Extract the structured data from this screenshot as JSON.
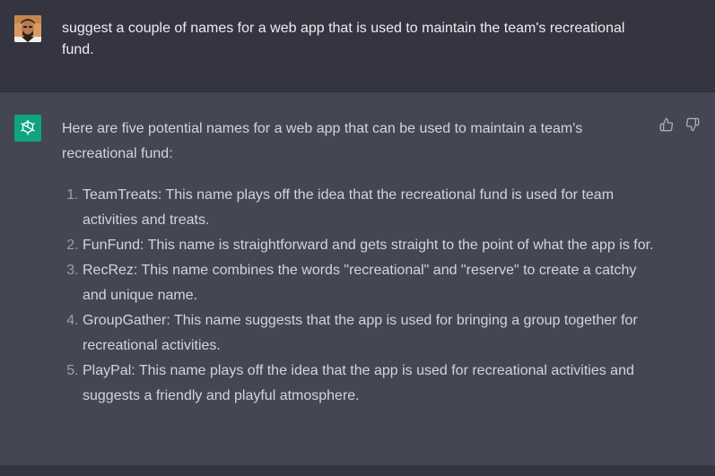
{
  "conversation": {
    "user_message": "suggest a couple of names for a web app that is used to maintain the team's recreational fund.",
    "assistant_intro": "Here are five potential names for a web app that can be used to maintain a team's recreational fund:",
    "assistant_list": [
      "TeamTreats: This name plays off the idea that the recreational fund is used for team activities and treats.",
      "FunFund: This name is straightforward and gets straight to the point of what the app is for.",
      "RecRez: This name combines the words \"recreational\" and \"reserve\" to create a catchy and unique name.",
      "GroupGather: This name suggests that the app is used for bringing a group together for recreational activities.",
      "PlayPal: This name plays off the idea that the app is used for recreational activities and suggests a friendly and playful atmosphere."
    ]
  },
  "icons": {
    "user_avatar": "user-avatar",
    "assistant_avatar": "openai-logo-icon",
    "feedback_up": "thumbs-up-icon",
    "feedback_down": "thumbs-down-icon"
  },
  "colors": {
    "background": "#343541",
    "assistant_background": "#444654",
    "accent": "#10a37f"
  }
}
